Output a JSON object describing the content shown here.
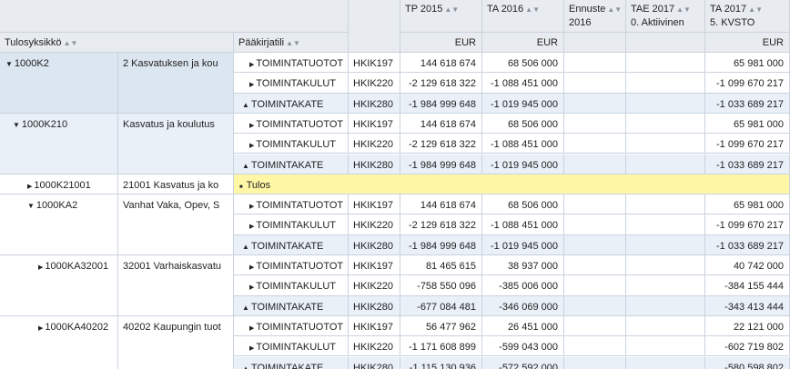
{
  "header": {
    "col_tp2015": "TP 2015",
    "col_ta2016": "TA 2016",
    "col_ennuste_1": "Ennuste",
    "col_ennuste_2": "2016",
    "col_tae2017_1": "TAE 2017",
    "col_tae2017_2": "0. Aktiivinen",
    "col_ta2017_1": "TA 2017",
    "col_ta2017_2": "5. KVSTO",
    "col_tulosyksikko": "Tulosyksikkö",
    "col_paakirjatili": "Pääkirjatili",
    "unit": "EUR",
    "sort_glyph": "▲▼"
  },
  "groups": [
    {
      "code": "1000K2",
      "name": "2 Kasvatuksen ja kou",
      "indent": 0,
      "expanded": true,
      "rows": [
        {
          "account": "TOIMINTATUOTOT",
          "hkik": "HKIK197",
          "tp2015": "144 618 674",
          "ta2016": "68 506 000",
          "ta2017": "65 981 000",
          "kind": "expand"
        },
        {
          "account": "TOIMINTAKULUT",
          "hkik": "HKIK220",
          "tp2015": "-2 129 618 322",
          "ta2016": "-1 088 451 000",
          "ta2017": "-1 099 670 217",
          "kind": "expand"
        },
        {
          "account": "TOIMINTAKATE",
          "hkik": "HKIK280",
          "tp2015": "-1 984 999 648",
          "ta2016": "-1 019 945 000",
          "ta2017": "-1 033 689 217",
          "kind": "collapse"
        }
      ]
    },
    {
      "code": "1000K210",
      "name": "Kasvatus ja koulutus",
      "indent": 1,
      "expanded": true,
      "rows": [
        {
          "account": "TOIMINTATUOTOT",
          "hkik": "HKIK197",
          "tp2015": "144 618 674",
          "ta2016": "68 506 000",
          "ta2017": "65 981 000",
          "kind": "expand"
        },
        {
          "account": "TOIMINTAKULUT",
          "hkik": "HKIK220",
          "tp2015": "-2 129 618 322",
          "ta2016": "-1 088 451 000",
          "ta2017": "-1 099 670 217",
          "kind": "expand"
        },
        {
          "account": "TOIMINTAKATE",
          "hkik": "HKIK280",
          "tp2015": "-1 984 999 648",
          "ta2016": "-1 019 945 000",
          "ta2017": "-1 033 689 217",
          "kind": "collapse"
        }
      ]
    },
    {
      "code": "1000K21001",
      "name": "21001 Kasvatus ja ko",
      "indent": 2,
      "expanded": false,
      "tulos_label": "Tulos"
    },
    {
      "code": "1000KA2",
      "name": "Vanhat Vaka, Opev, S",
      "indent": 2,
      "expanded": true,
      "rows": [
        {
          "account": "TOIMINTATUOTOT",
          "hkik": "HKIK197",
          "tp2015": "144 618 674",
          "ta2016": "68 506 000",
          "ta2017": "65 981 000",
          "kind": "expand"
        },
        {
          "account": "TOIMINTAKULUT",
          "hkik": "HKIK220",
          "tp2015": "-2 129 618 322",
          "ta2016": "-1 088 451 000",
          "ta2017": "-1 099 670 217",
          "kind": "expand"
        },
        {
          "account": "TOIMINTAKATE",
          "hkik": "HKIK280",
          "tp2015": "-1 984 999 648",
          "ta2016": "-1 019 945 000",
          "ta2017": "-1 033 689 217",
          "kind": "collapse"
        }
      ]
    },
    {
      "code": "1000KA32001",
      "name": "32001 Varhaiskasvatu",
      "indent": 3,
      "expanded": false,
      "rows": [
        {
          "account": "TOIMINTATUOTOT",
          "hkik": "HKIK197",
          "tp2015": "81 465 615",
          "ta2016": "38 937 000",
          "ta2017": "40 742 000",
          "kind": "expand"
        },
        {
          "account": "TOIMINTAKULUT",
          "hkik": "HKIK220",
          "tp2015": "-758 550 096",
          "ta2016": "-385 006 000",
          "ta2017": "-384 155 444",
          "kind": "expand"
        },
        {
          "account": "TOIMINTAKATE",
          "hkik": "HKIK280",
          "tp2015": "-677 084 481",
          "ta2016": "-346 069 000",
          "ta2017": "-343 413 444",
          "kind": "collapse"
        }
      ]
    },
    {
      "code": "1000KA40202",
      "name": "40202 Kaupungin tuot",
      "indent": 3,
      "expanded": false,
      "rows": [
        {
          "account": "TOIMINTATUOTOT",
          "hkik": "HKIK197",
          "tp2015": "56 477 962",
          "ta2016": "26 451 000",
          "ta2017": "22 121 000",
          "kind": "expand"
        },
        {
          "account": "TOIMINTAKULUT",
          "hkik": "HKIK220",
          "tp2015": "-1 171 608 899",
          "ta2016": "-599 043 000",
          "ta2017": "-602 719 802",
          "kind": "expand"
        },
        {
          "account": "TOIMINTAKATE",
          "hkik": "HKIK280",
          "tp2015": "-1 115 130 936",
          "ta2016": "-572 592 000",
          "ta2017": "-580 598 802",
          "kind": "collapse"
        }
      ]
    }
  ],
  "colors": {
    "header_bg": "#e8ebef",
    "row_blue": "#dce6f1",
    "row_lightblue": "#e9f0f8",
    "tulos_yellow": "#fff7a6",
    "grid_line": "#c9d3de"
  }
}
